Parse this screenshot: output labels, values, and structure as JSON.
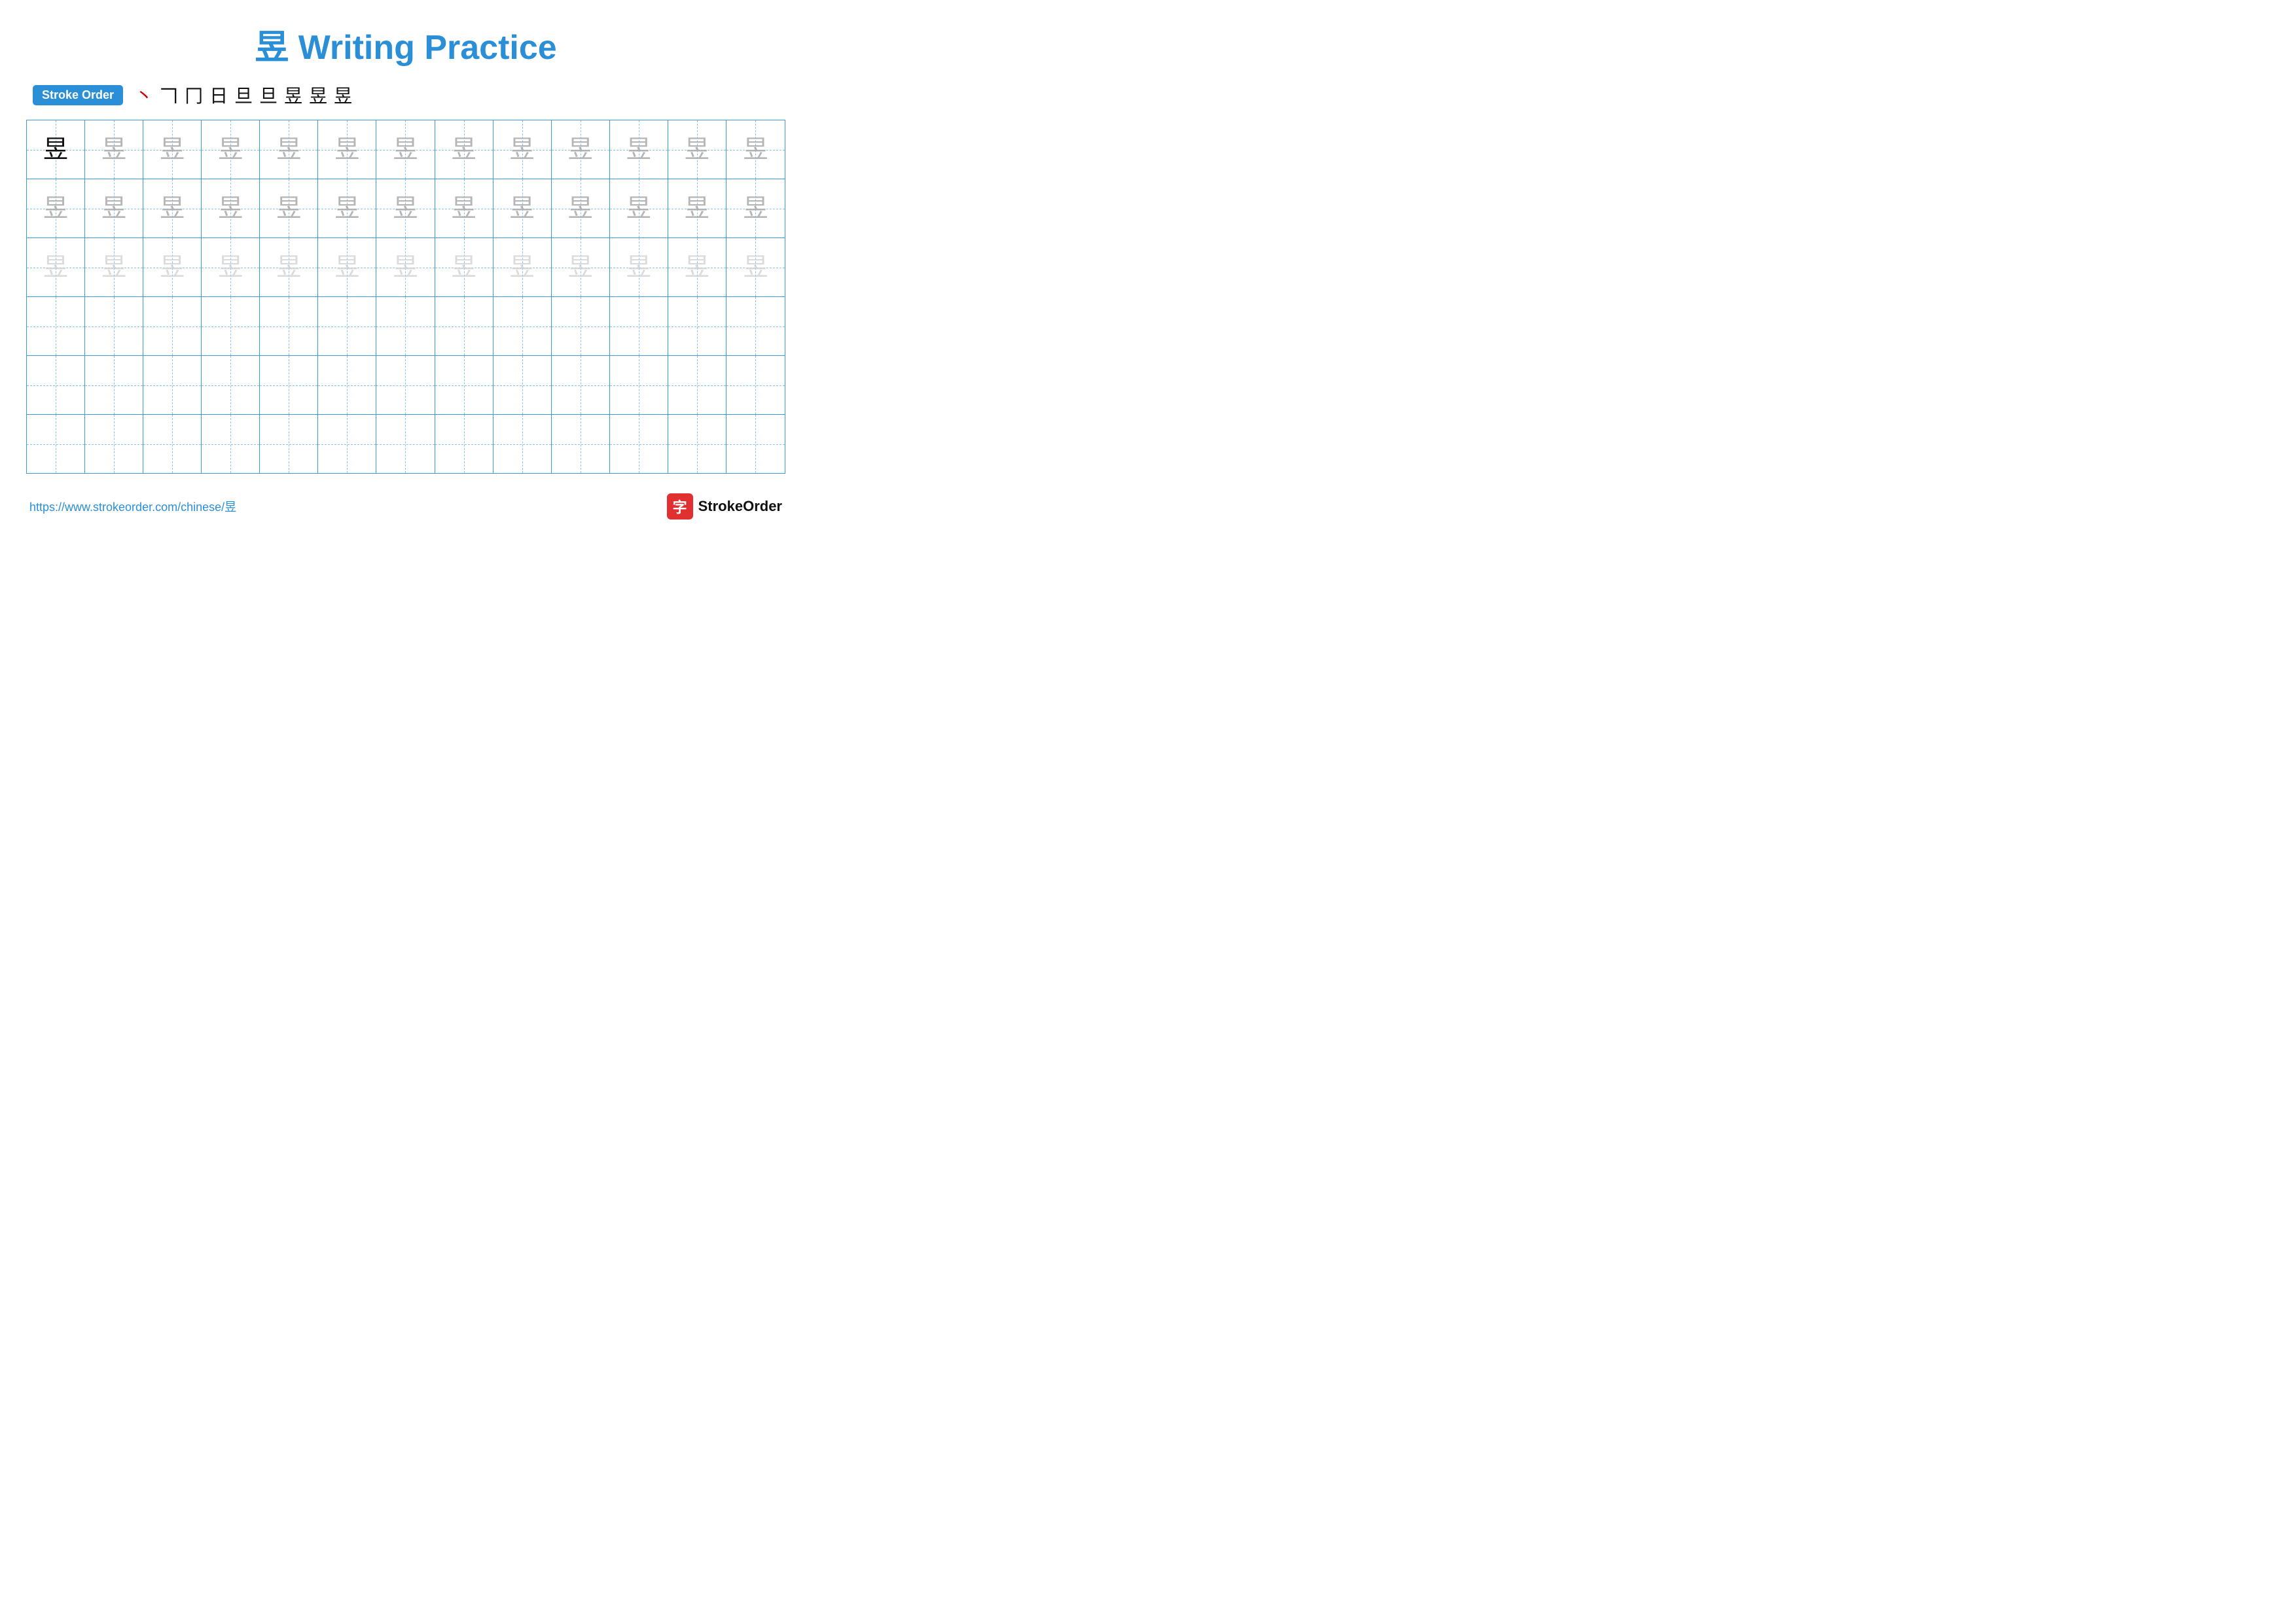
{
  "title": {
    "character": "昱",
    "text": "Writing Practice",
    "full": "昱 Writing Practice"
  },
  "stroke_order": {
    "badge_label": "Stroke Order",
    "steps": [
      "丶",
      "𠃍",
      "冂",
      "日",
      "旦",
      "旦",
      "昱",
      "昱",
      "昱"
    ]
  },
  "grid": {
    "rows": 6,
    "cols": 13,
    "character": "昱",
    "row_styles": [
      "dark",
      "medium-gray",
      "light-gray",
      "empty",
      "empty",
      "empty"
    ]
  },
  "footer": {
    "url": "https://www.strokeorder.com/chinese/昱",
    "logo_text": "StrokeOrder",
    "logo_icon": "字"
  }
}
